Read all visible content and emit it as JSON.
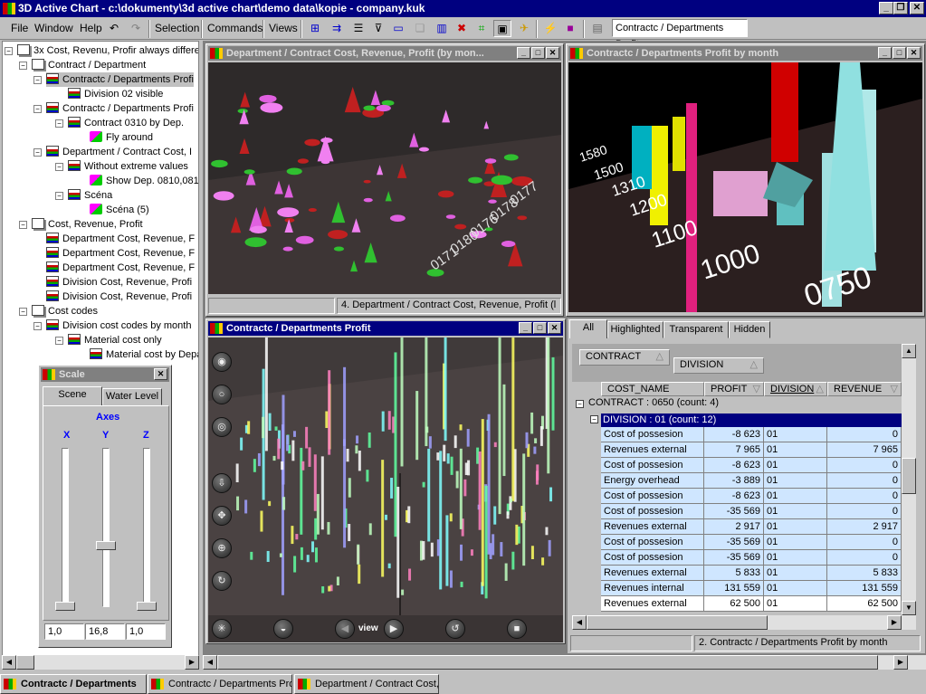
{
  "app": {
    "title": "3D Active Chart - c:\\dokumenty\\3d active chart\\demo data\\kopie - company.kuk"
  },
  "menu": {
    "file": "File",
    "window": "Window",
    "help": "Help",
    "selection": "Selection",
    "commands": "Commands",
    "views": "Views",
    "view_combo": "Contractc / Departments Profit"
  },
  "tree": [
    {
      "label": "3x Cost, Revenu, Profir always differe",
      "icon": "window-group-icon"
    },
    {
      "label": "Contract / Department",
      "icon": "window-group-icon"
    },
    {
      "label": "Contractc / Departments Profi",
      "icon": "chart-window-icon"
    },
    {
      "label": "Division 02 visible",
      "icon": "scene-icon"
    },
    {
      "label": "Contractc / Departments Profi",
      "icon": "chart-window-icon"
    },
    {
      "label": "Contract 0310 by Dep.",
      "icon": "scene-icon"
    },
    {
      "label": "Fly around",
      "icon": "fly-icon"
    },
    {
      "label": "Department / Contract Cost, I",
      "icon": "chart-window-icon"
    },
    {
      "label": "Without extreme values",
      "icon": "scene-icon"
    },
    {
      "label": "Show Dep. 0810,081",
      "icon": "fly-icon"
    },
    {
      "label": "Scéna",
      "icon": "scene-icon"
    },
    {
      "label": "Scéna (5)",
      "icon": "fly-icon"
    },
    {
      "label": "Cost, Revenue, Profit",
      "icon": "window-group-icon"
    },
    {
      "label": "Department Cost, Revenue, F",
      "icon": "chart-window-icon"
    },
    {
      "label": "Department Cost, Revenue, F",
      "icon": "chart-window-icon"
    },
    {
      "label": "Department Cost, Revenue, F",
      "icon": "chart-window-icon"
    },
    {
      "label": "Division Cost, Revenue, Profi",
      "icon": "chart-window-icon"
    },
    {
      "label": "Division Cost, Revenue, Profi",
      "icon": "chart-window-icon"
    },
    {
      "label": "Cost codes",
      "icon": "window-group-icon"
    },
    {
      "label": "Division cost codes by month",
      "icon": "chart-window-icon"
    },
    {
      "label": "Material cost only",
      "icon": "scene-icon"
    },
    {
      "label": "Material cost by Depa",
      "icon": "scene-icon"
    }
  ],
  "scale": {
    "title": "Scale",
    "tab_scene": "Scene",
    "tab_water": "Water Level",
    "axes_label": "Axes",
    "x": "X",
    "y": "Y",
    "z": "Z",
    "x_value": "1,0",
    "y_value": "16,8",
    "z_value": "1,0"
  },
  "win1": {
    "title": "Department / Contract Cost, Revenue, Profit (by mon...",
    "status": "4. Department / Contract Cost, Revenue, Profit (l"
  },
  "win2": {
    "title": "Contractc / Departments Profit by month",
    "status": "2. Contractc / Departments Profit by month",
    "axis_labels": [
      "1580",
      "1500",
      "1310",
      "1200",
      "1100",
      "1000",
      "0750"
    ]
  },
  "win3": {
    "title": "Contractc / Departments Profit",
    "view_label": "view"
  },
  "win1_axis": [
    "0171",
    "0180",
    "0176",
    "0178",
    "0177"
  ],
  "grid": {
    "tabs": [
      "All",
      "Highlighted",
      "Transparent",
      "Hidden"
    ],
    "group_contract": "CONTRACT",
    "group_division": "DIVISION",
    "columns": [
      "COST_NAME",
      "PROFIT",
      "DIVISION",
      "REVENUE"
    ],
    "contract_group": "CONTRACT : 0650  (count: 4)",
    "division_group": "DIVISION : 01  (count: 12)",
    "rows": [
      [
        "Cost of possesion",
        "-8 623",
        "01",
        "0"
      ],
      [
        "Revenues external",
        "7 965",
        "01",
        "7 965"
      ],
      [
        "Cost of possesion",
        "-8 623",
        "01",
        "0"
      ],
      [
        "Energy overhead",
        "-3 889",
        "01",
        "0"
      ],
      [
        "Cost of possesion",
        "-8 623",
        "01",
        "0"
      ],
      [
        "Cost of possesion",
        "-35 569",
        "01",
        "0"
      ],
      [
        "Revenues external",
        "2 917",
        "01",
        "2 917"
      ],
      [
        "Cost of possesion",
        "-35 569",
        "01",
        "0"
      ],
      [
        "Cost of possesion",
        "-35 569",
        "01",
        "0"
      ],
      [
        "Revenues external",
        "5 833",
        "01",
        "5 833"
      ],
      [
        "Revenues internal",
        "131 559",
        "01",
        "131 559"
      ],
      [
        "Revenues external",
        "62 500",
        "01",
        "62 500"
      ]
    ]
  },
  "taskbar": [
    "Contractc / Departments",
    "Contractc / Departments Prof",
    "Department / Contract Cost,"
  ],
  "colors": {
    "active_title": "#000080",
    "inactive_title": "#808080",
    "chrome": "#c0c0c0",
    "selection": "#000080"
  }
}
